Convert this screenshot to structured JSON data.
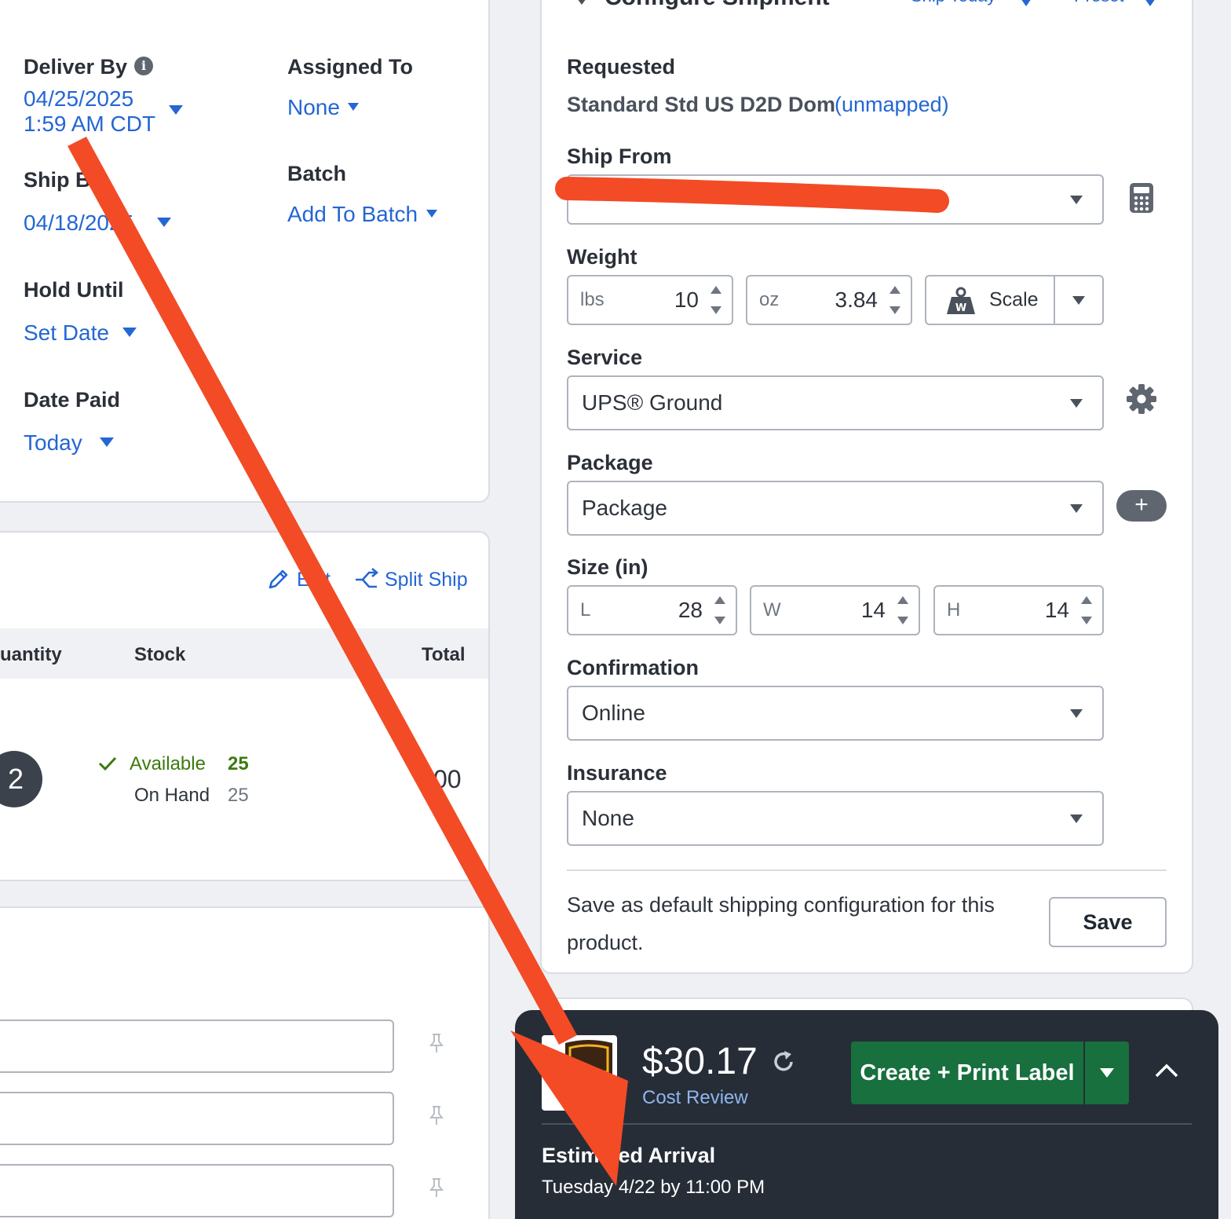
{
  "left_panel": {
    "deliver_by": {
      "label": "Deliver By",
      "date": "04/25/2025",
      "time": "1:59 AM CDT"
    },
    "assigned_to": {
      "label": "Assigned To",
      "value": "None"
    },
    "ship_by": {
      "label": "Ship B",
      "value": "04/18/2025"
    },
    "batch": {
      "label": "Batch",
      "value": "Add To Batch"
    },
    "hold_until": {
      "label": "Hold Until",
      "value": "Set Date"
    },
    "date_paid": {
      "label": "Date Paid",
      "value": "Today"
    }
  },
  "items": {
    "edit_label": "Edit",
    "split_ship_label": "Split Ship",
    "columns": {
      "quantity": "uantity",
      "stock": "Stock",
      "total": "Total"
    },
    "row": {
      "quantity": "2",
      "available_label": "Available",
      "available_value": "25",
      "on_hand_label": "On Hand",
      "on_hand_value": "25",
      "total": "00"
    }
  },
  "config": {
    "title": "Configure Shipment",
    "ship_today": "Ship Today",
    "preset": "Preset",
    "requested_label": "Requested",
    "requested_service": "Standard Std US D2D Dom",
    "requested_unmapped": "(unmapped)",
    "ship_from_label": "Ship From",
    "weight": {
      "label": "Weight",
      "lbs_unit": "lbs",
      "lbs": "10",
      "oz_unit": "oz",
      "oz": "3.84",
      "scale_label": "Scale"
    },
    "service": {
      "label": "Service",
      "value": "UPS® Ground"
    },
    "package": {
      "label": "Package",
      "value": "Package"
    },
    "size": {
      "label": "Size (in)",
      "l_unit": "L",
      "l": "28",
      "w_unit": "W",
      "w": "14",
      "h_unit": "H",
      "h": "14"
    },
    "confirmation": {
      "label": "Confirmation",
      "value": "Online"
    },
    "insurance": {
      "label": "Insurance",
      "value": "None"
    },
    "save_default_text": "Save as default shipping configuration for this product.",
    "save_button": "Save"
  },
  "bottom_bar": {
    "price": "$30.17",
    "cost_review": "Cost Review",
    "create_label": "Create + Print Label",
    "estimated_label": "Estimated Arrival",
    "estimated_date": "Tuesday 4/22 by 11:00 PM"
  },
  "colors": {
    "link": "#2466d4",
    "available_green": "#3d7a0e",
    "create_button": "#17703d",
    "bottom_bar": "#262d37",
    "annotation_red": "#f24b26"
  }
}
